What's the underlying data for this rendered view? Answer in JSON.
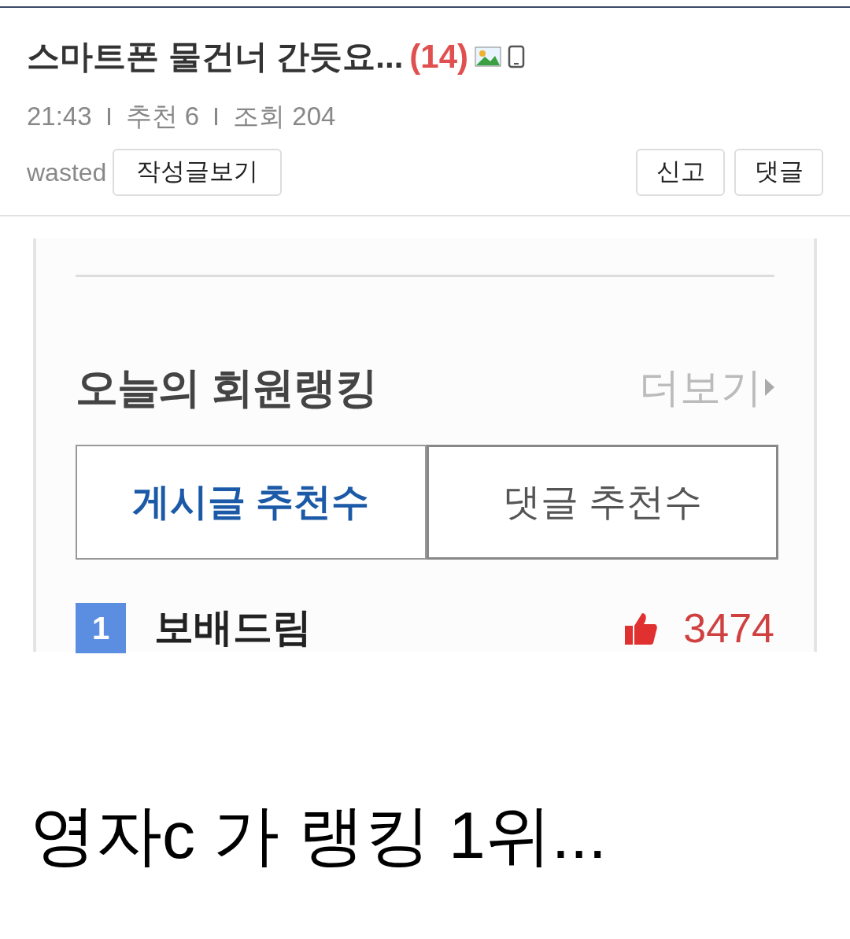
{
  "post": {
    "title": "스마트폰 물건너 간듯요...",
    "comment_count": "(14)",
    "time": "21:43",
    "recommend": "추천 6",
    "views": "조회 204",
    "author": "wasted",
    "author_button": "작성글보기",
    "actions": [
      "신고",
      "댓글"
    ]
  },
  "embedded": {
    "heading": "오늘의 회원랭킹",
    "more": "더보기",
    "tabs": [
      {
        "label": "게시글 추천수",
        "selected": true
      },
      {
        "label": "댓글 추천수",
        "selected": false
      }
    ],
    "ranking": [
      {
        "rank": "1",
        "name": "보배드림",
        "score": "3474"
      }
    ]
  },
  "body_text": "영자c 가 랭킹 1위..."
}
